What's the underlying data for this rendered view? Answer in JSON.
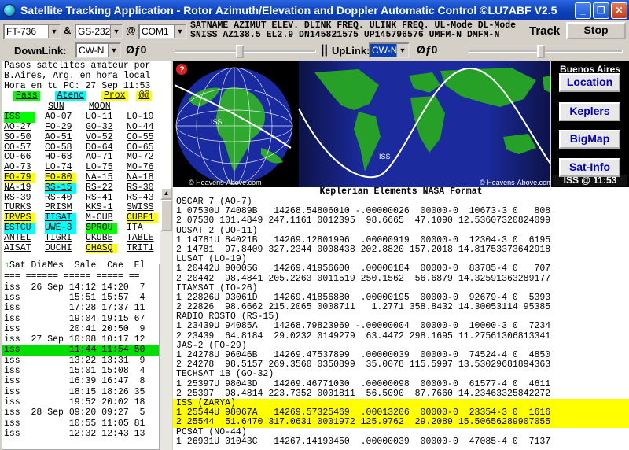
{
  "window": {
    "title": "Satellite Tracking Application - Rotor Azimuth/Elevation and Doppler Automatic Control  ©LU7ABF    V2.5",
    "minimize": "_",
    "maximize": "❐",
    "close": "✕"
  },
  "toolbar": {
    "radio": "FT-736",
    "amp": "&",
    "rotor": "GS-232",
    "at": "@",
    "port": "COM1",
    "track_label": "Track",
    "stop_label": "Stop",
    "downlink_label": "DownLink:",
    "downlink_mode": "CW-N",
    "downlink_df": "Øƒ0",
    "sep": "||",
    "uplink_label": "UpLink:",
    "uplink_mode": "CW-N",
    "uplink_df": "Øƒ0",
    "sat_header": "SATNAME AZIMUT ELEV. DLINK FREQ. ULINK FREQ. UL-Mode DL-Mode",
    "sat_values": "SNISS AZ138.5 EL2.9 DN145821575 UP145796576 UMFM-N DMFM-N",
    "downlink_slider": 0.46,
    "uplink_slider": 0.47
  },
  "left": {
    "intro": [
      "Pasos satelites amateur por",
      "B.Aires, Arg. en hora local",
      "Hora en tu PC: 27 Sep 11:53"
    ],
    "buttons": {
      "pass": "Pass",
      "atenc": "Atenc",
      "prox": "Prox",
      "at": "@@"
    },
    "sun": "SUN",
    "moon": "MOON",
    "sats": [
      [
        "ISS",
        "AO-07",
        "UO-11",
        "LO-19"
      ],
      [
        "AO-27",
        "FO-29",
        "GO-32",
        "NO-44"
      ],
      [
        "SO-50",
        "AO-51",
        "VO-52",
        "CO-55"
      ],
      [
        "CO-57",
        "CO-58",
        "DO-64",
        "CO-65"
      ],
      [
        "CO-66",
        "HO-68",
        "AO-71",
        "MO-72"
      ],
      [
        "AO-73",
        "LO-74",
        "LO-75",
        "MO-76"
      ],
      [
        "EO-79",
        "EO-80",
        "NA-15",
        "NA-18"
      ],
      [
        "NA-19",
        "RS-15",
        "RS-22",
        "RS-30"
      ],
      [
        "RS-39",
        "RS-40",
        "RS-41",
        "RS-43"
      ],
      [
        "TURKS",
        "PRISM",
        "KKS-1",
        "SWISS"
      ],
      [
        "IRVPS",
        "TISAT",
        "M-CUB",
        "CUBE1"
      ],
      [
        "ESTCU",
        "UWE-3",
        "SPROU",
        "ITA"
      ],
      [
        "ANTEL",
        "TIGRI",
        "UKUBE",
        "TABLE"
      ],
      [
        "AISAT",
        "DUCHI",
        "CHASQ",
        "TRIT1"
      ]
    ],
    "pass_header": "Sat DiaMes  Sale  Cae  El",
    "passes": [
      "=== ====== ===== ===== ==",
      "iss  26 Sep 14:12 14:20  7",
      "iss         15:51 15:57  4",
      "iss         17:28 17:37 11",
      "iss         19:04 19:15 67",
      "iss         20:41 20:50  9",
      "iss  27 Sep 10:08 10:17 12",
      "iss         11:44 11:54 50",
      "iss         13:22 13:31  9",
      "iss         15:01 15:08  4",
      "iss         16:39 16:47  8",
      "iss         18:15 18:26 35",
      "iss         19:52 20:02 18",
      "iss  28 Sep 09:20 09:27  5",
      "iss         10:55 11:05 81",
      "iss         12:32 12:43 13"
    ]
  },
  "map": {
    "globe_caption": "© Heavens-Above.com",
    "flat_caption": "© Heavens-Above.com",
    "city": "Buenos Aires",
    "status": "ISS @ 11:53",
    "sat_label": "ISS",
    "help": "?"
  },
  "side_buttons": [
    "Location",
    "Keplers",
    "BigMap",
    "Sat-Info"
  ],
  "keplers": {
    "header": "Keplerian Elements NASA Format",
    "lines": [
      "OSCAR 7 (AO-7)",
      "1 07530U 74089B   14268.54806010 -.00000026  00000-0  10673-3 0   808",
      "2 07530 101.4849 247.1161 0012395  98.6665  47.1090 12.53607320824099",
      "UOSAT 2 (UO-11)",
      "1 14781U 84021B   14269.12801996  .00000919  00000-0  12304-3 0  6195",
      "2 14781  97.8409 327.2344 0008438 202.8820 157.2018 14.81753373642918",
      "LUSAT (LO-19)",
      "1 20442U 90005G   14269.41956600  .00000184  00000-0  83785-4 0   707",
      "2 20442  98.4841 205.2263 0011519 250.1562  56.6879 14.32591363289177",
      "ITAMSAT (IO-26)",
      "1 22826U 93061D   14269.41856880  .00000195  00000-0  92679-4 0  5393",
      "2 22826  98.6662 215.2065 0008711   1.2771 358.8432 14.30053114 95385",
      "RADIO ROSTO (RS-15)",
      "1 23439U 94085A   14268.79823969 -.00000004  00000-0  10000-3 0  7234",
      "2 23439  64.8184  29.0232 0149279  63.4472 298.1695 11.27561306813341",
      "JAS-2 (FO-29)",
      "1 24278U 96046B   14269.47537899  .00000039  00000-0  74524-4 0  4850",
      "2 24278  98.5157 269.3560 0350899  35.0078 115.5997 13.53029681894363",
      "TECHSAT 1B (GO-32)",
      "1 25397U 98043D   14269.46771030  .00000098  00000-0  61577-4 0  4611",
      "2 25397  98.4814 223.7352 0001811  56.5090  87.7660 14.23463325842272",
      "ISS (ZARYA)",
      "1 25544U 98067A   14269.57325469  .00013206  00000-0  23354-3 0  1616",
      "2 25544  51.6470 317.0631 0001972 125.9762  29.2089 15.50656289907055",
      "PCSAT (NO-44)",
      "1 26931U 01043C   14267.14190450  .00000039  00000-0  47085-4 0  7137"
    ],
    "highlight": [
      21,
      22,
      23
    ]
  },
  "colors": {
    "title_blue": "#0a3fb8",
    "pass_green": "#00ff00",
    "atenc_cyan": "#00ffff",
    "prox_yellow": "#ffff00",
    "active_row": "#00e000",
    "kep_highlight": "#ffff00",
    "button_text": "#0000c0"
  }
}
